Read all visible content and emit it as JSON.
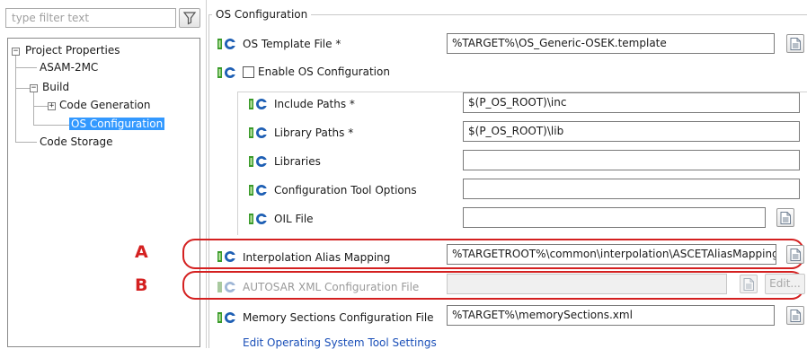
{
  "filter": {
    "placeholder": "type filter text"
  },
  "tree": {
    "root": "Project Properties",
    "asam": "ASAM-2MC",
    "build": "Build",
    "code_generation": "Code Generation",
    "os_configuration": "OS Configuration",
    "code_storage": "Code Storage"
  },
  "panel": {
    "group_title": "OS Configuration",
    "os_template_label": "OS Template File *",
    "os_template_value": "%TARGET%\\OS_Generic-OSEK.template",
    "enable_os_label": "Enable OS Configuration",
    "include_paths_label": "Include Paths *",
    "include_paths_value": "$(P_OS_ROOT)\\inc",
    "library_paths_label": "Library Paths *",
    "library_paths_value": "$(P_OS_ROOT)\\lib",
    "libraries_label": "Libraries",
    "libraries_value": "",
    "config_tool_label": "Configuration Tool Options",
    "config_tool_value": "",
    "oil_file_label": "OIL File",
    "oil_file_value": "",
    "interp_label": "Interpolation Alias Mapping",
    "interp_value": "%TARGETROOT%\\common\\interpolation\\ASCETAliasMapping.ini",
    "autosar_label": "AUTOSAR XML Configuration File",
    "autosar_value": "",
    "edit_button": "Edit...",
    "memory_label": "Memory Sections Configuration File",
    "memory_value": "%TARGET%\\memorySections.xml",
    "link": "Edit Operating System Tool Settings"
  },
  "markers": {
    "a": "A",
    "b": "B"
  },
  "colors": {
    "selection": "#3399ff",
    "marker": "#d42020",
    "link": "#1a4fb8",
    "icon_blue": "#1e5fb4",
    "icon_green": "#3a9a2a"
  }
}
